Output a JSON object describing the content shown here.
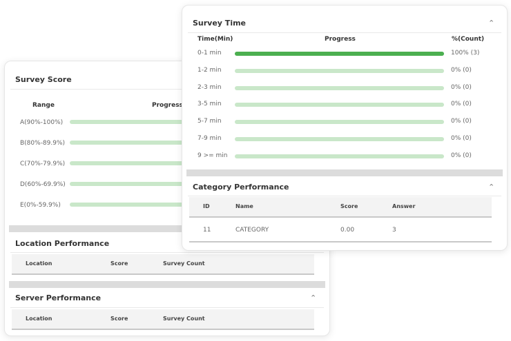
{
  "survey_score": {
    "title": "Survey Score",
    "headers": {
      "range": "Range",
      "progress": "Progress"
    },
    "rows": [
      {
        "label": "A(90%-100%)",
        "value": 0
      },
      {
        "label": "B(80%-89.9%)",
        "value": 0
      },
      {
        "label": "C(70%-79.9%)",
        "value": 0
      },
      {
        "label": "D(60%-69.9%)",
        "value": 0
      },
      {
        "label": "E(0%-59.9%)",
        "value": 0
      }
    ]
  },
  "location_performance": {
    "title": "Location Performance",
    "columns": [
      "Location",
      "Score",
      "Survey Count"
    ]
  },
  "server_performance": {
    "title": "Server Performance",
    "columns": [
      "Location",
      "Score",
      "Survey Count"
    ]
  },
  "survey_time": {
    "title": "Survey Time",
    "headers": {
      "time": "Time(Min)",
      "progress": "Progress",
      "count": "%(Count)"
    },
    "rows": [
      {
        "label": "0-1 min",
        "value": 1.0,
        "pct": "100% (3)"
      },
      {
        "label": "1-2 min",
        "value": 0,
        "pct": "0% (0)"
      },
      {
        "label": "2-3 min",
        "value": 0,
        "pct": "0% (0)"
      },
      {
        "label": "3-5 min",
        "value": 0,
        "pct": "0% (0)"
      },
      {
        "label": "5-7 min",
        "value": 0,
        "pct": "0% (0)"
      },
      {
        "label": "7-9 min",
        "value": 0,
        "pct": "0% (0)"
      },
      {
        "label": "9 >= min",
        "value": 0,
        "pct": "0% (0)"
      }
    ]
  },
  "category_performance": {
    "title": "Category Performance",
    "columns": [
      "ID",
      "Name",
      "Score",
      "Answer"
    ],
    "rows": [
      [
        "11",
        "CATEGORY",
        "0.00",
        "3"
      ]
    ]
  },
  "icons": {
    "collapse": "chevron-up-icon"
  },
  "colors": {
    "bar_fill": "#4caf50",
    "bar_track": "#c9e7c9",
    "divider": "#dcdcdc"
  }
}
